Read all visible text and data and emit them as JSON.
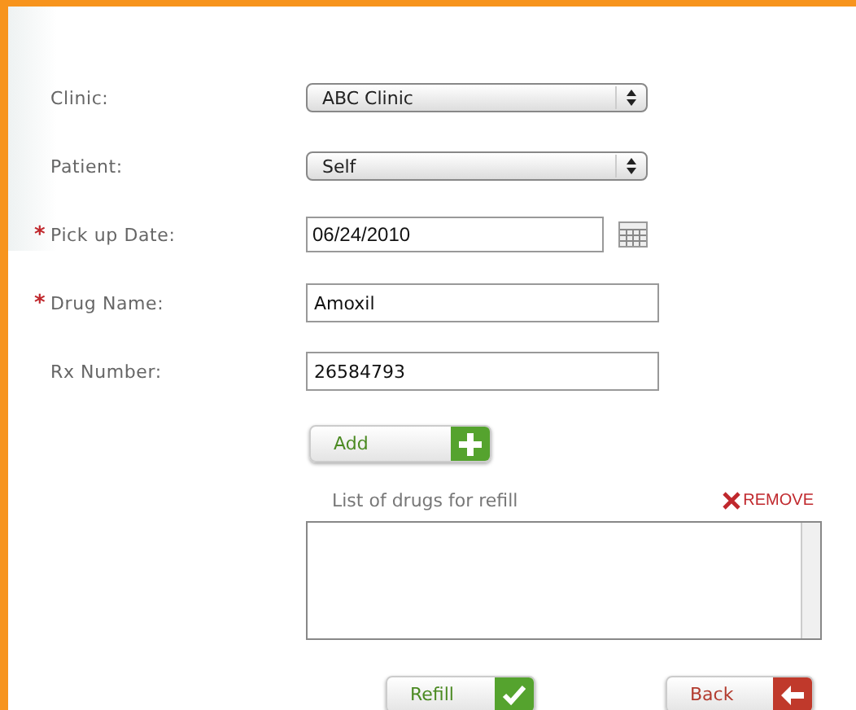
{
  "fields": [
    {
      "label": "Clinic:",
      "required": false,
      "kind": "select",
      "value": "ABC Clinic"
    },
    {
      "label": "Patient:",
      "required": false,
      "kind": "select",
      "value": "Self"
    },
    {
      "label": "Pick up Date:",
      "required": true,
      "kind": "date",
      "value": "06/24/2010"
    },
    {
      "label": "Drug Name:",
      "required": true,
      "kind": "text",
      "value": "Amoxil"
    },
    {
      "label": "Rx Number:",
      "required": false,
      "kind": "text",
      "value": "26584793"
    }
  ],
  "required_mark": "*",
  "add_button": "Add",
  "drug_list": {
    "label": "List of drugs for refill",
    "remove": "REMOVE"
  },
  "buttons": [
    {
      "label": "Refill",
      "kind": "confirm"
    },
    {
      "label": "Back",
      "kind": "back"
    }
  ]
}
